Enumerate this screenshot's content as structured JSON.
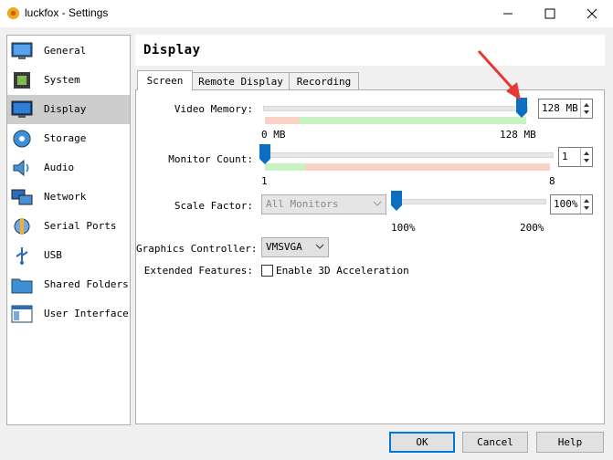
{
  "window": {
    "title": "luckfox - Settings"
  },
  "sidebar": {
    "items": [
      {
        "label": "General",
        "icon": "general-monitor-icon"
      },
      {
        "label": "System",
        "icon": "system-chip-icon"
      },
      {
        "label": "Display",
        "icon": "display-monitor-icon"
      },
      {
        "label": "Storage",
        "icon": "storage-disc-icon"
      },
      {
        "label": "Audio",
        "icon": "audio-speaker-icon"
      },
      {
        "label": "Network",
        "icon": "network-icon"
      },
      {
        "label": "Serial Ports",
        "icon": "serial-port-icon"
      },
      {
        "label": "USB",
        "icon": "usb-icon"
      },
      {
        "label": "Shared Folders",
        "icon": "folder-icon"
      },
      {
        "label": "User Interface",
        "icon": "user-interface-icon"
      }
    ],
    "selected": "Display"
  },
  "header": {
    "title": "Display"
  },
  "tabs": [
    {
      "label": "Screen",
      "selected": true
    },
    {
      "label": "Remote Display",
      "selected": false
    },
    {
      "label": "Recording",
      "selected": false
    }
  ],
  "screen": {
    "video_memory": {
      "label": "Video Memory:",
      "value": "128 MB",
      "level": 1.0,
      "min_label": "0 MB",
      "max_label": "128 MB"
    },
    "monitor_count": {
      "label": "Monitor Count:",
      "value": "1",
      "level": 0.0,
      "min_label": "1",
      "max_label": "8"
    },
    "scale_factor": {
      "label": "Scale Factor:",
      "monitor_select": "All Monitors",
      "value": "100%",
      "level": 0.0,
      "min_label": "100%",
      "max_label": "200%"
    },
    "graphics_controller": {
      "label": "Graphics Controller:",
      "value": "VMSVGA"
    },
    "extended_features": {
      "label": "Extended Features:",
      "checkbox_label": "Enable 3D Acceleration",
      "checked": false
    }
  },
  "buttons": {
    "ok": "OK",
    "cancel": "Cancel",
    "help": "Help"
  },
  "colors": {
    "selection": "#cdcdcd",
    "slider_thumb": "#0a6fc2",
    "green_range": "#c9f2c3",
    "red_range": "#f8d2c4",
    "annotation_arrow": "#e53935"
  }
}
